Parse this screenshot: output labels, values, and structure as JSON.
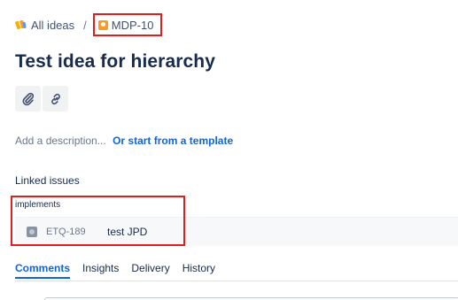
{
  "breadcrumb": {
    "all_ideas_label": "All ideas",
    "separator": "/",
    "issue_key": "MDP-10",
    "idea_icon_color": "#ff991f"
  },
  "title": "Test idea for hierarchy",
  "actions": {
    "attach_icon": "paperclip-icon",
    "link_icon": "link-icon"
  },
  "description": {
    "placeholder": "Add a description...",
    "template_link": "Or start from a template"
  },
  "linked_issues": {
    "heading": "Linked issues",
    "relation": "implements",
    "items": [
      {
        "key": "ETQ-189",
        "summary": "test JPD",
        "icon": "issue-type-icon"
      }
    ]
  },
  "tabs": [
    {
      "label": "Comments",
      "active": true
    },
    {
      "label": "Insights",
      "active": false
    },
    {
      "label": "Delivery",
      "active": false
    },
    {
      "label": "History",
      "active": false
    }
  ],
  "colors": {
    "accent": "#0c66e4",
    "highlight_border": "#e01e1e"
  }
}
